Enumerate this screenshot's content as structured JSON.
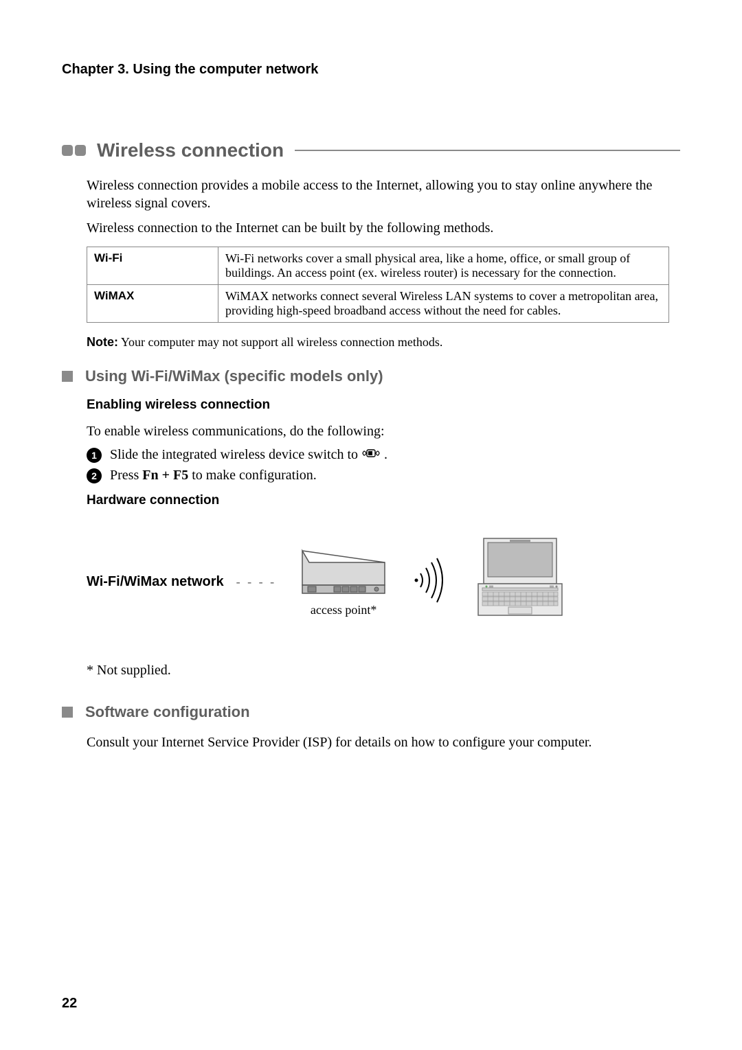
{
  "chapter_header": "Chapter 3. Using the computer network",
  "section": {
    "title": "Wireless connection",
    "intro1": "Wireless connection provides a mobile access to the Internet, allowing you to stay online anywhere the wireless signal covers.",
    "intro2": "Wireless connection to the Internet can be built by the following methods."
  },
  "table": {
    "wifi_name": "Wi-Fi",
    "wifi_desc": "Wi-Fi networks cover a small physical area, like a home, office, or small group of buildings. An access point (ex. wireless router) is necessary for the connection.",
    "wimax_name": "WiMAX",
    "wimax_desc": "WiMAX networks connect several Wireless LAN systems to cover a metropolitan area, providing high-speed broadband access without the need for cables."
  },
  "note": {
    "label": "Note:",
    "text": " Your computer may not support all wireless connection methods."
  },
  "sub1": {
    "title": "Using Wi-Fi/WiMax (specific models only)",
    "enable_heading": "Enabling wireless connection",
    "enable_intro": "To enable wireless communications, do the following:",
    "step1_pre": "Slide the integrated wireless device switch to ",
    "step1_post": ".",
    "step2_pre": "Press ",
    "step2_key": "Fn + F5",
    "step2_post": " to make configuration.",
    "hw_heading": "Hardware connection",
    "hw_label": "Wi-Fi/WiMax network",
    "ap_caption": "access point*",
    "footnote": "* Not supplied."
  },
  "sub2": {
    "title": "Software configuration",
    "text": "Consult your Internet Service Provider (ISP) for details on how to configure your computer."
  },
  "page_number": "22"
}
